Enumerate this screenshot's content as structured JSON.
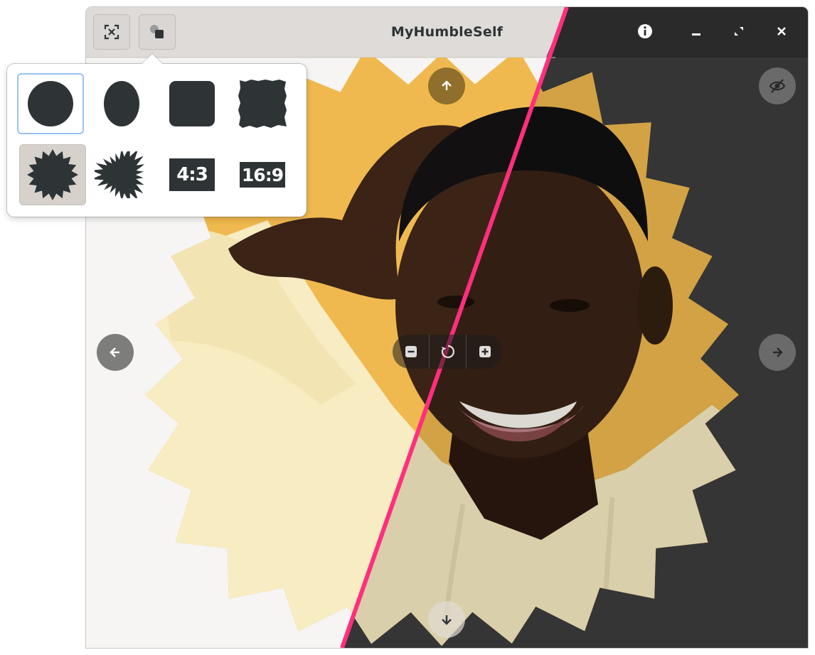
{
  "window": {
    "title": "MyHumbleSelf"
  },
  "colors": {
    "light_bg": "#f6f5f4",
    "dark_bg": "#353535",
    "divider": "#ff2f7d",
    "badge": "#f0b94f",
    "skin": "#3b2316",
    "hoodie": "#f7ecc2",
    "shape_fill": "#2e3436",
    "focus": "#99c1f1"
  },
  "header": {
    "left_buttons": [
      {
        "name": "face-detect-icon"
      },
      {
        "name": "shapes-icon"
      }
    ],
    "right_buttons": [
      {
        "name": "info-icon"
      },
      {
        "name": "minimize-icon"
      },
      {
        "name": "maximize-icon"
      },
      {
        "name": "close-icon"
      }
    ]
  },
  "shapes_popover": {
    "items": [
      {
        "name": "circle",
        "selected": false,
        "focused": true
      },
      {
        "name": "ellipse",
        "selected": false,
        "focused": false
      },
      {
        "name": "rounded-square",
        "selected": false,
        "focused": false
      },
      {
        "name": "rough-square",
        "selected": false,
        "focused": false
      },
      {
        "name": "starburst",
        "selected": true,
        "focused": false
      },
      {
        "name": "splat",
        "selected": false,
        "focused": false
      },
      {
        "name": "ratio-4-3",
        "label": "4:3",
        "selected": false,
        "focused": false
      },
      {
        "name": "ratio-16-9",
        "label": "16:9",
        "selected": false,
        "focused": false
      }
    ]
  },
  "navigation": {
    "up": "arrow-up-icon",
    "down": "arrow-down-icon",
    "left": "arrow-left-icon",
    "right": "arrow-right-icon"
  },
  "zoom_controls": [
    "zoom-out-icon",
    "zoom-reset-icon",
    "zoom-in-icon"
  ],
  "toggle_preview": "eye-hidden-icon"
}
